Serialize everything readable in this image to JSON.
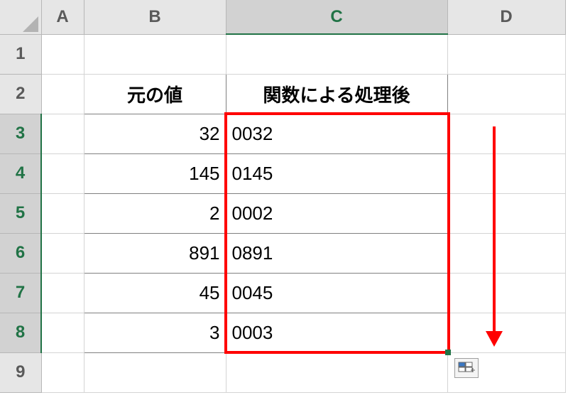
{
  "columns": {
    "A": "A",
    "B": "B",
    "C": "C",
    "D": "D"
  },
  "rows": [
    "1",
    "2",
    "3",
    "4",
    "5",
    "6",
    "7",
    "8",
    "9"
  ],
  "headers": {
    "B": "元の値",
    "C": "関数による処理後"
  },
  "data": [
    {
      "orig": "32",
      "proc": "0032"
    },
    {
      "orig": "145",
      "proc": "0145"
    },
    {
      "orig": "2",
      "proc": "0002"
    },
    {
      "orig": "891",
      "proc": "0891"
    },
    {
      "orig": "45",
      "proc": "0045"
    },
    {
      "orig": "3",
      "proc": "0003"
    }
  ],
  "selection": {
    "col": "C",
    "rows_from": 3,
    "rows_to": 8,
    "active": "C3"
  },
  "icons": {
    "select_all": "select-all-triangle",
    "autofill": "auto-fill-options-icon"
  }
}
